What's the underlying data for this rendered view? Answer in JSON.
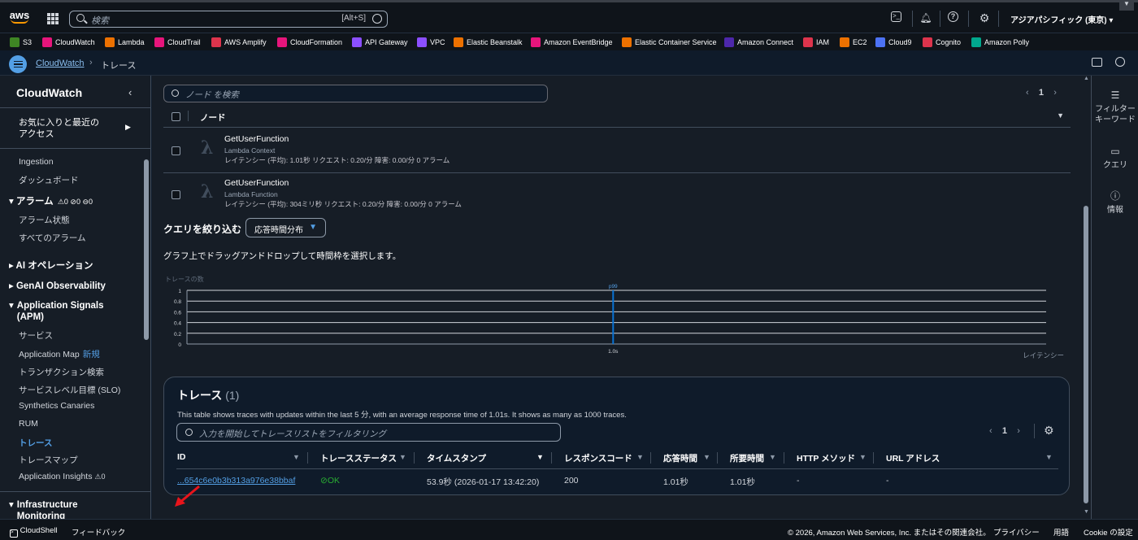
{
  "top": {
    "logo": "aws",
    "search_placeholder": "検索",
    "search_shortcut": "[Alt+S]",
    "region": "アジアパシフィック (東京) ▾"
  },
  "favorites": [
    {
      "label": "S3",
      "color": "#3f8624"
    },
    {
      "label": "CloudWatch",
      "color": "#e7157b"
    },
    {
      "label": "Lambda",
      "color": "#ed7100"
    },
    {
      "label": "CloudTrail",
      "color": "#e7157b"
    },
    {
      "label": "AWS Amplify",
      "color": "#dd344c"
    },
    {
      "label": "CloudFormation",
      "color": "#e7157b"
    },
    {
      "label": "API Gateway",
      "color": "#8c4fff"
    },
    {
      "label": "VPC",
      "color": "#8c4fff"
    },
    {
      "label": "Elastic Beanstalk",
      "color": "#ed7100"
    },
    {
      "label": "Amazon EventBridge",
      "color": "#e7157b"
    },
    {
      "label": "Elastic Container Service",
      "color": "#ed7100"
    },
    {
      "label": "Amazon Connect",
      "color": "#4d27aa"
    },
    {
      "label": "IAM",
      "color": "#dd344c"
    },
    {
      "label": "EC2",
      "color": "#ed7100"
    },
    {
      "label": "Cloud9",
      "color": "#4d72f3"
    },
    {
      "label": "Cognito",
      "color": "#dd344c"
    },
    {
      "label": "Amazon Polly",
      "color": "#01a88d"
    }
  ],
  "breadcrumb": {
    "link": "CloudWatch",
    "current": "トレース"
  },
  "sidebar": {
    "title": "CloudWatch",
    "favorites": "お気に入りと最近の\nアクセス",
    "items": {
      "ingestion": "Ingestion",
      "dashboard": "ダッシュボード",
      "alarms": "アラーム",
      "alarm_counts": [
        "0",
        "0",
        "0"
      ],
      "alarm_state": "アラーム状態",
      "all_alarms": "すべてのアラーム",
      "ai_ops": "AI オペレーション",
      "genai": "GenAI Observability",
      "app_signals": "Application Signals\n(APM)",
      "services": "サービス",
      "app_map": "Application Map",
      "app_map_badge": "新規",
      "transaction": "トランザクション検索",
      "slo": "サービスレベル目標 (SLO)",
      "synthetics": "Synthetics Canaries",
      "rum": "RUM",
      "traces": "トレース",
      "trace_map": "トレースマップ",
      "app_insights": "Application Insights",
      "app_insights_count": "0",
      "infra": "Infrastructure\nMonitoring"
    }
  },
  "nodes": {
    "search_placeholder": "ノード を検索",
    "page": "1",
    "header": "ノード",
    "rows": [
      {
        "name": "GetUserFunction",
        "type": "Lambda Context",
        "stats": "レイテンシー (平均): 1.01秒   リクエスト: 0.20/分   障害: 0.00/分   0 アラーム"
      },
      {
        "name": "GetUserFunction",
        "type": "Lambda Function",
        "stats": "レイテンシー (平均): 304ミリ秒   リクエスト: 0.20/分   障害: 0.00/分   0 アラーム"
      }
    ]
  },
  "refine": {
    "label": "クエリを絞り込む",
    "dropdown": "応答時間分布",
    "hint": "グラフ上でドラッグアンドドロップして時間枠を選択します。"
  },
  "chart_data": {
    "type": "bar",
    "ylabel": "トレースの数",
    "xlabel": "レイテンシー",
    "yticks": [
      "1",
      "0.8",
      "0.6",
      "0.4",
      "0.2",
      "0"
    ],
    "ylim": [
      0,
      1
    ],
    "categories": [
      "1.0s"
    ],
    "values": [
      1
    ],
    "annotation": "p99"
  },
  "traces": {
    "title": "トレース",
    "count": "(1)",
    "description": "This table shows traces with updates within the last 5 分, with an average response time of 1.01s. It shows as many as 1000 traces.",
    "filter_placeholder": "入力を開始してトレースリストをフィルタリング",
    "page": "1",
    "columns": [
      "ID",
      "トレースステータス",
      "タイムスタンプ",
      "レスポンスコード",
      "応答時間",
      "所要時間",
      "HTTP メソッド",
      "URL アドレス"
    ],
    "row": {
      "id": "...654c6e0b3b313a976e38bbaf",
      "status": "OK",
      "timestamp": "53.9秒 (2026-01-17 13:42:20)",
      "code": "200",
      "response": "1.01秒",
      "duration": "1.01秒",
      "method": "-",
      "url": "-"
    }
  },
  "rightpanel": {
    "filter": "フィルター\nキーワード",
    "query": "クエリ",
    "info": "情報"
  },
  "footer": {
    "cloudshell": "CloudShell",
    "feedback": "フィードバック",
    "copyright": "© 2026, Amazon Web Services, Inc. またはその関連会社。",
    "privacy": "プライバシー",
    "terms": "用語",
    "cookie": "Cookie の設定"
  }
}
